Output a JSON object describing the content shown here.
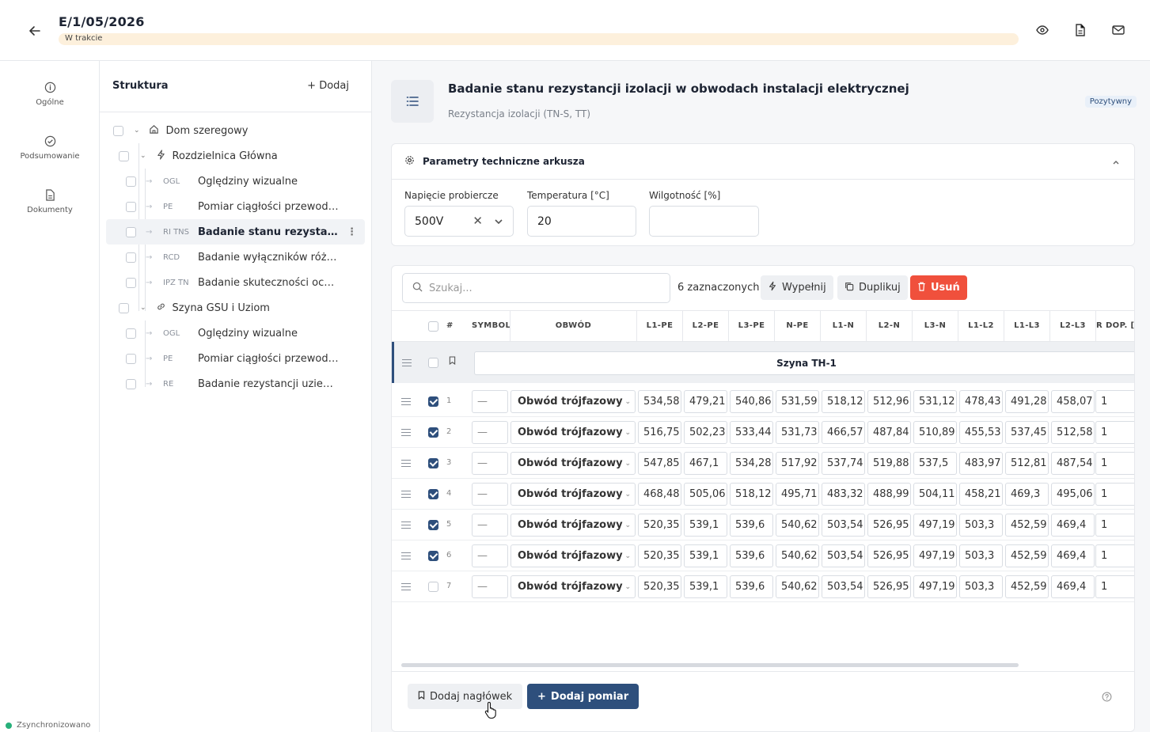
{
  "header": {
    "title": "E/1/05/2026",
    "status": "W trakcie"
  },
  "nav": [
    {
      "label": "Ogólne",
      "icon": "info-icon"
    },
    {
      "label": "Podsumowanie",
      "icon": "check-circle-icon"
    },
    {
      "label": "Dokumenty",
      "icon": "document-icon"
    }
  ],
  "sync_label": "Zsynchronizowano",
  "tree": {
    "title": "Struktura",
    "add_label": "Dodaj",
    "nodes": [
      {
        "label": "Dom szeregowy",
        "code": ""
      },
      {
        "label": "Rozdzielnica Główna",
        "code": ""
      },
      {
        "label": "Oględziny wizualne",
        "code": "OGL"
      },
      {
        "label": "Pomiar ciągłości przewodó...",
        "code": "PE"
      },
      {
        "label": "Badanie stanu rezystancji ...",
        "code": "RI TNS"
      },
      {
        "label": "Badanie wyłączników różnic...",
        "code": "RCD"
      },
      {
        "label": "Badanie skuteczności ochr...",
        "code": "IPZ TN"
      },
      {
        "label": "Szyna GSU i Uziom",
        "code": ""
      },
      {
        "label": "Oględziny wizualne",
        "code": "OGL"
      },
      {
        "label": "Pomiar ciągłości przewodó...",
        "code": "PE"
      },
      {
        "label": "Badanie rezystancji uziemie...",
        "code": "RE"
      }
    ]
  },
  "test": {
    "title": "Badanie stanu rezystancji izolacji w obwodach instalacji elektrycznej",
    "subtitle": "Rezystancja izolacji (TN-S, TT)",
    "result_badge": "Pozytywny"
  },
  "params": {
    "title": "Parametry techniczne arkusza",
    "voltage_label": "Napięcie probiercze",
    "voltage_value": "500V",
    "temp_label": "Temperatura [°C]",
    "temp_value": "20",
    "humidity_label": "Wilgotność [%]",
    "humidity_value": ""
  },
  "toolbar": {
    "search_placeholder": "Szukaj...",
    "selected_count": "6 zaznaczonych",
    "fill_label": "Wypełnij",
    "duplicate_label": "Duplikuj",
    "delete_label": "Usuń"
  },
  "table": {
    "columns": [
      "#",
      "SYMBOL",
      "OBWÓD",
      "L1-PE",
      "L2-PE",
      "L3-PE",
      "N-PE",
      "L1-N",
      "L2-N",
      "L3-N",
      "L1-L2",
      "L1-L3",
      "L2-L3",
      "R DOP. [M"
    ],
    "group_header": "Szyna TH-1",
    "rows": [
      {
        "n": "1",
        "checked": true,
        "symbol": "—",
        "obwod": "Obwód trójfazowy",
        "vals": [
          "534,58",
          "479,21",
          "540,86",
          "531,59",
          "518,12",
          "512,96",
          "531,12",
          "478,43",
          "491,28",
          "458,07"
        ],
        "rdop": "1"
      },
      {
        "n": "2",
        "checked": true,
        "symbol": "—",
        "obwod": "Obwód trójfazowy",
        "vals": [
          "516,75",
          "502,23",
          "533,44",
          "531,73",
          "466,57",
          "487,84",
          "510,89",
          "455,53",
          "537,45",
          "512,58"
        ],
        "rdop": "1"
      },
      {
        "n": "3",
        "checked": true,
        "symbol": "—",
        "obwod": "Obwód trójfazowy",
        "vals": [
          "547,85",
          "467,1",
          "534,28",
          "517,92",
          "537,74",
          "519,88",
          "537,5",
          "483,97",
          "512,81",
          "487,54"
        ],
        "rdop": "1"
      },
      {
        "n": "4",
        "checked": true,
        "symbol": "—",
        "obwod": "Obwód trójfazowy",
        "vals": [
          "468,48",
          "505,06",
          "518,12",
          "495,71",
          "483,32",
          "488,99",
          "504,11",
          "458,21",
          "469,3",
          "495,06"
        ],
        "rdop": "1"
      },
      {
        "n": "5",
        "checked": true,
        "symbol": "—",
        "obwod": "Obwód trójfazowy",
        "vals": [
          "520,35",
          "539,1",
          "539,6",
          "540,62",
          "503,54",
          "526,95",
          "497,19",
          "503,3",
          "452,59",
          "469,4"
        ],
        "rdop": "1"
      },
      {
        "n": "6",
        "checked": true,
        "symbol": "—",
        "obwod": "Obwód trójfazowy",
        "vals": [
          "520,35",
          "539,1",
          "539,6",
          "540,62",
          "503,54",
          "526,95",
          "497,19",
          "503,3",
          "452,59",
          "469,4"
        ],
        "rdop": "1"
      },
      {
        "n": "7",
        "checked": false,
        "symbol": "—",
        "obwod": "Obwód trójfazowy",
        "vals": [
          "520,35",
          "539,1",
          "539,6",
          "540,62",
          "503,54",
          "526,95",
          "497,19",
          "503,3",
          "452,59",
          "469,4"
        ],
        "rdop": "1"
      }
    ]
  },
  "footer": {
    "add_header_label": "Dodaj nagłówek",
    "add_measurement_label": "Dodaj pomiar"
  },
  "colors": {
    "accent": "#2e4f7c",
    "danger": "#f0503c",
    "status_bg": "#fdf0dc",
    "sync": "#27b07a"
  }
}
